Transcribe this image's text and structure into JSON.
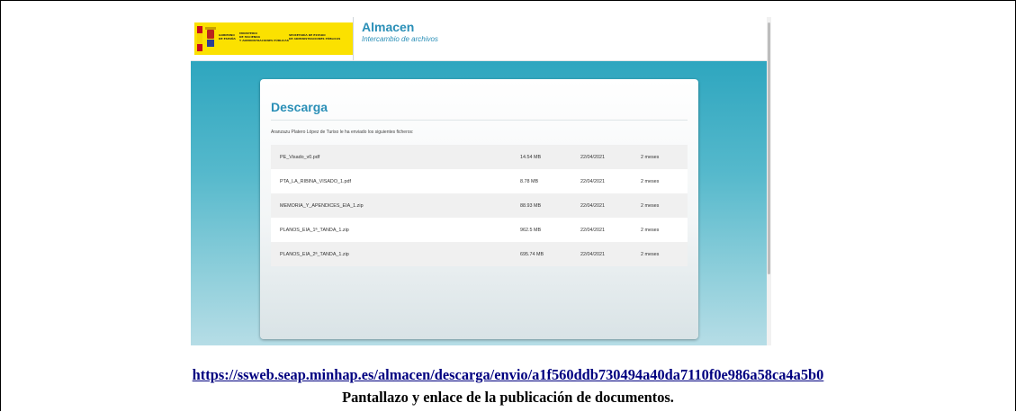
{
  "header": {
    "logo_lines_left": [
      "GOBIERNO",
      "DE ESPAÑA"
    ],
    "logo_lines_mid": [
      "MINISTERIO",
      "DE HACIENDA",
      "Y ADMINISTRACIONES PÚBLICAS"
    ],
    "logo_lines_right": [
      "SECRETARÍA DE ESTADO",
      "DE ADMINISTRACIONES PÚBLICAS"
    ],
    "app_title": "Almacen",
    "app_subtitle": "Intercambio de archivos"
  },
  "card": {
    "title": "Descarga",
    "message": "Aranzazu Platero López de Turiso le ha enviado los siguientes ficheros:",
    "files": [
      {
        "name": "PE_Visado_v0.pdf",
        "size": "14.54 MB",
        "date": "22/04/2021",
        "expires": "2 meses"
      },
      {
        "name": "PTA_LA_RIBINA_VISADO_1.pdf",
        "size": "8.78 MB",
        "date": "22/04/2021",
        "expires": "2 meses"
      },
      {
        "name": "MEMORIA_Y_APENDICES_EIA_1.zip",
        "size": "88.93 MB",
        "date": "22/04/2021",
        "expires": "2 meses"
      },
      {
        "name": "PLANOS_EIA_1ª_TANDA_1.zip",
        "size": "962.5 MB",
        "date": "22/04/2021",
        "expires": "2 meses"
      },
      {
        "name": "PLANOS_EIA_2ª_TANDA_1.zip",
        "size": "695.74 MB",
        "date": "22/04/2021",
        "expires": "2 meses"
      }
    ]
  },
  "document": {
    "link": "https://ssweb.seap.minhap.es/almacen/descarga/envio/a1f560ddb730494a40da7110f0e986a58ca4a5b0",
    "caption": "Pantallazo y enlace de la publicación de documentos."
  },
  "colors": {
    "accent": "#2a8fb7",
    "teal": "#2ea6bf",
    "logo_yellow": "#fbe100"
  }
}
